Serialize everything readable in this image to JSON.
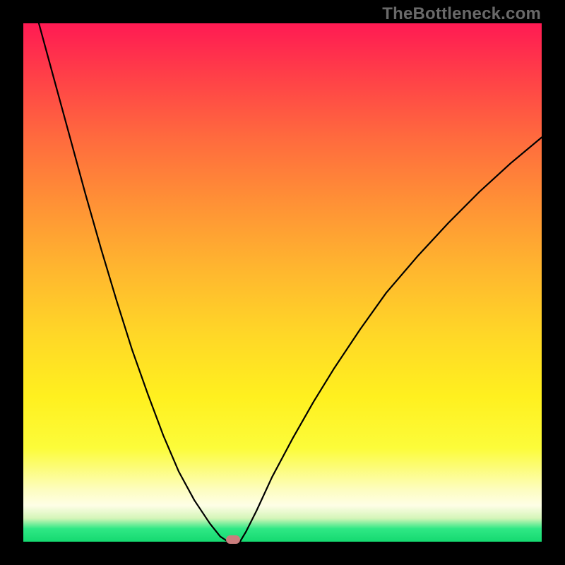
{
  "watermark": {
    "text": "TheBottleneck.com"
  },
  "chart_data": {
    "type": "line",
    "title": "",
    "xlabel": "",
    "ylabel": "",
    "xlim": [
      0,
      100
    ],
    "ylim": [
      0,
      100
    ],
    "grid": false,
    "legend": false,
    "description": "V-shaped bottleneck curve over a vertical red-to-green gradient; minimum near x≈40 at y≈0.",
    "series": [
      {
        "name": "left-branch",
        "x": [
          3,
          6,
          9,
          12,
          15,
          18,
          21,
          24,
          27,
          30,
          33,
          36,
          38,
          39.5
        ],
        "y": [
          100,
          89,
          78,
          67,
          56.5,
          46.5,
          37,
          28.5,
          20.5,
          13.5,
          8,
          3.5,
          1,
          0
        ]
      },
      {
        "name": "right-branch",
        "x": [
          41.8,
          43,
          45,
          48,
          52,
          56,
          60,
          65,
          70,
          76,
          82,
          88,
          94,
          100
        ],
        "y": [
          0,
          2,
          6,
          12.5,
          20,
          27,
          33.5,
          41,
          48,
          55,
          61.5,
          67.5,
          73,
          78
        ]
      }
    ],
    "marker": {
      "x": 40.5,
      "y": 0,
      "color": "#cb7d7d"
    },
    "gradient_stops": [
      {
        "pos": 0,
        "color": "#ff1a53"
      },
      {
        "pos": 0.47,
        "color": "#ffb52f"
      },
      {
        "pos": 0.72,
        "color": "#fff01f"
      },
      {
        "pos": 0.93,
        "color": "#fefee6"
      },
      {
        "pos": 1.0,
        "color": "#15d970"
      }
    ]
  }
}
